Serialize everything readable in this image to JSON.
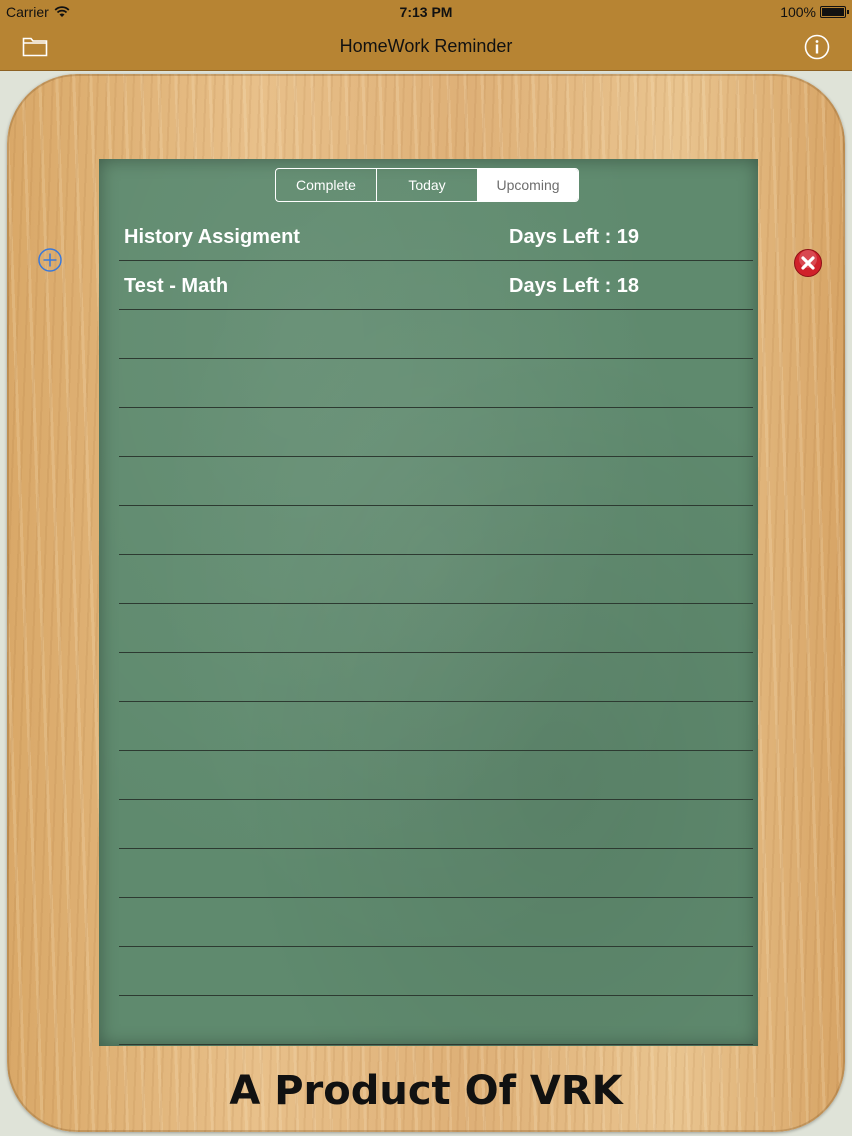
{
  "status_bar": {
    "carrier": "Carrier",
    "time": "7:13 PM",
    "battery": "100%"
  },
  "nav": {
    "title": "HomeWork Reminder",
    "left_icon": "folder-icon",
    "right_icon": "info-icon"
  },
  "segments": [
    {
      "label": "Complete",
      "active": false
    },
    {
      "label": "Today",
      "active": false
    },
    {
      "label": "Upcoming",
      "active": true
    }
  ],
  "assignments": [
    {
      "name": "History Assigment",
      "days": "Days Left : 19"
    },
    {
      "name": "Test - Math",
      "days": "Days Left : 18"
    }
  ],
  "empty_rows": 15,
  "footer": {
    "text": "A Product Of VRK"
  },
  "colors": {
    "nav": "#b78433",
    "board": "#5f8a6e",
    "delete": "#d0202a",
    "add": "#3a78d8"
  }
}
